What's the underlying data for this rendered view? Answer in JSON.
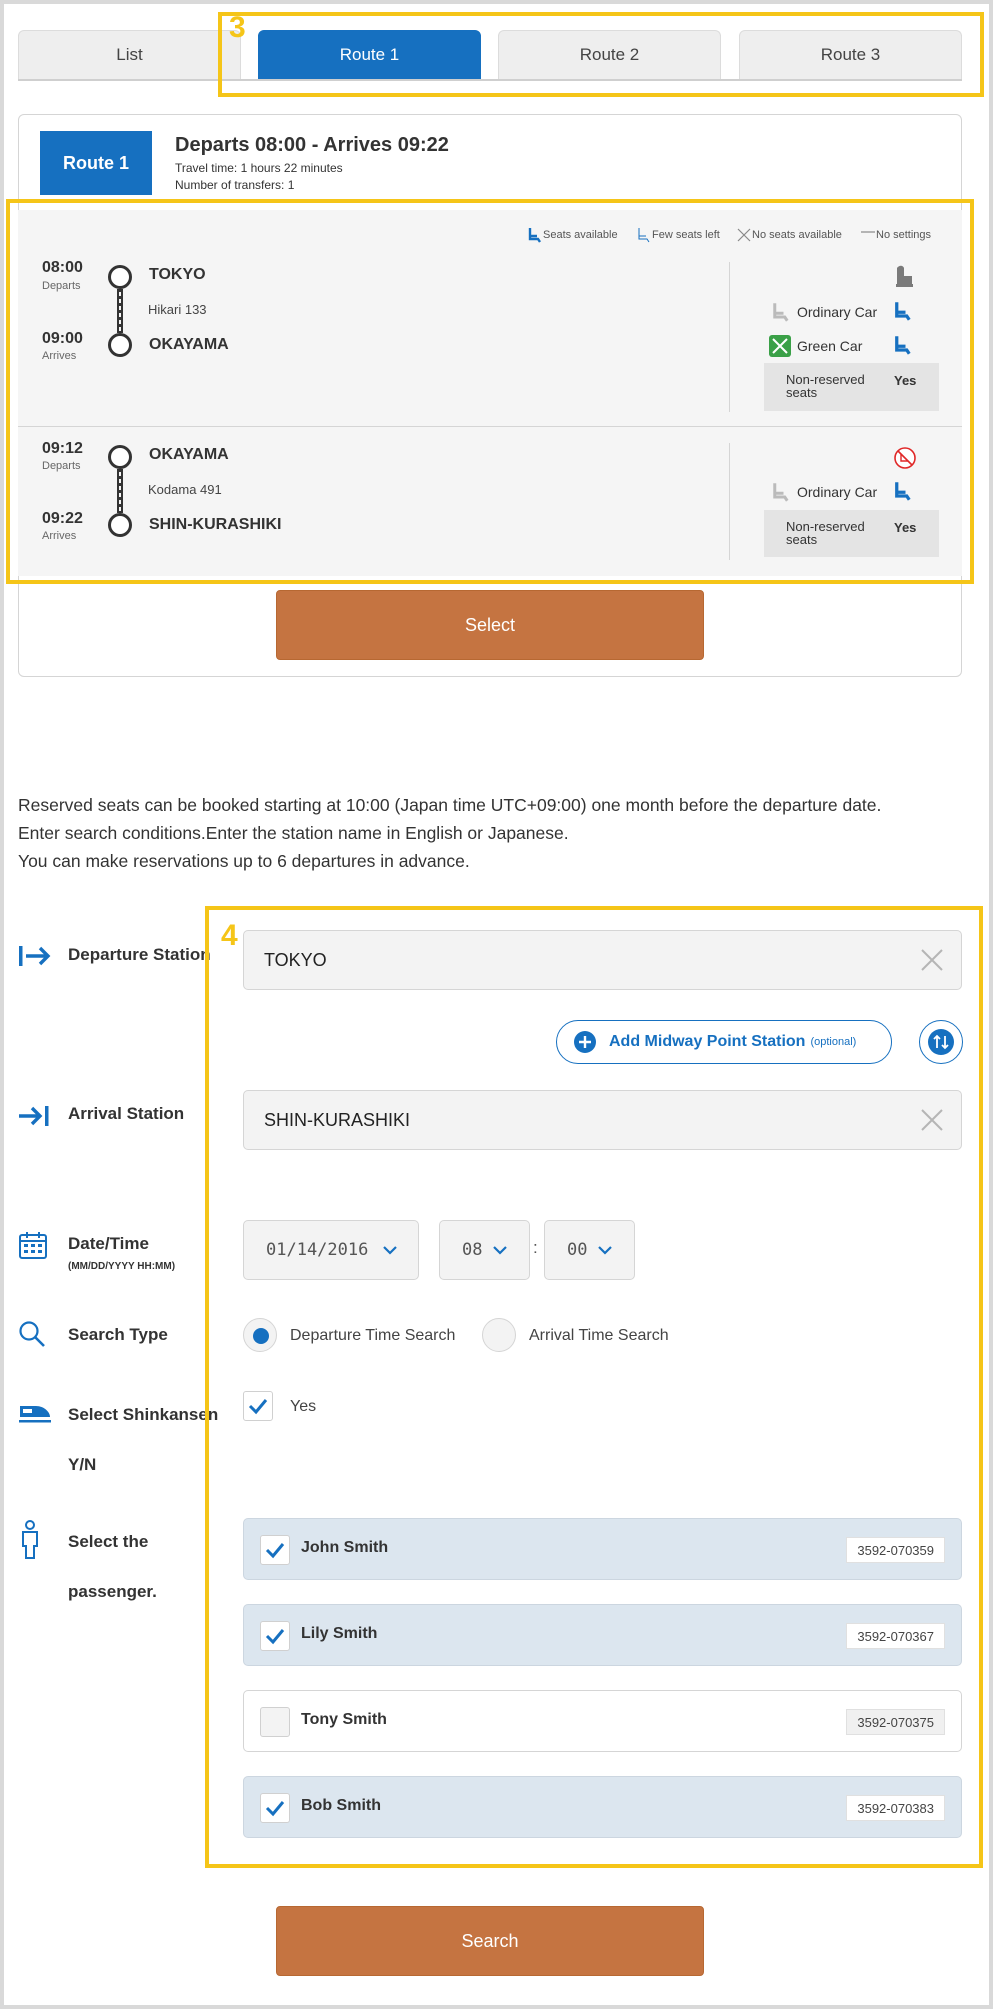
{
  "tabs": [
    {
      "label": "List"
    },
    {
      "label": "Route 1"
    },
    {
      "label": "Route 2"
    },
    {
      "label": "Route 3"
    }
  ],
  "annotations": {
    "box3": "3",
    "box4": "4"
  },
  "summary": {
    "badge": "Route 1",
    "title": "Departs 08:00 - Arrives 09:22",
    "travel_time": "Travel time: 1 hours 22 minutes",
    "transfers": "Number of transfers: 1"
  },
  "legend": {
    "seats_available": "Seats available",
    "few_seats": "Few seats left",
    "no_seats": "No seats available",
    "no_settings": "No settings"
  },
  "legs": [
    {
      "dep_time": "08:00",
      "dep_label": "Departs",
      "dep_station": "TOKYO",
      "train": "Hikari 133",
      "arr_time": "09:00",
      "arr_label": "Arrives",
      "arr_station": "OKAYAMA",
      "ordinary": "Ordinary Car",
      "green": "Green Car",
      "nonreserved_label": "Non-reserved seats",
      "nonreserved_value": "Yes"
    },
    {
      "dep_time": "09:12",
      "dep_label": "Departs",
      "dep_station": "OKAYAMA",
      "train": "Kodama 491",
      "arr_time": "09:22",
      "arr_label": "Arrives",
      "arr_station": "SHIN-KURASHIKI",
      "ordinary": "Ordinary Car",
      "nonreserved_label": "Non-reserved seats",
      "nonreserved_value": "Yes"
    }
  ],
  "select_button": "Select",
  "info": [
    "Reserved seats can be booked starting at 10:00 (Japan time UTC+09:00) one month before the departure date.",
    "Enter search conditions.Enter the station name in English or Japanese.",
    "You can make reservations up to 6 departures in advance."
  ],
  "form": {
    "departure_label": "Departure Station",
    "departure_value": "TOKYO",
    "midway_label": "Add Midway Point Station",
    "midway_optional": "(optional)",
    "arrival_label": "Arrival Station",
    "arrival_value": "SHIN-KURASHIKI",
    "datetime_label": "Date/Time",
    "datetime_format": "(MM/DD/YYYY HH:MM)",
    "date_value": "01/14/2016",
    "hour_value": "08",
    "minute_value": "00",
    "time_sep": ":",
    "search_type_label": "Search Type",
    "search_departure": "Departure Time Search",
    "search_arrival": "Arrival Time Search",
    "shinkansen_label": "Select Shinkansen",
    "shinkansen_yn": "Y/N",
    "shinkansen_yes": "Yes",
    "passenger_label_1": "Select the",
    "passenger_label_2": "passenger."
  },
  "passengers": [
    {
      "name": "John Smith",
      "id": "3592-070359",
      "checked": true
    },
    {
      "name": "Lily Smith",
      "id": "3592-070367",
      "checked": true
    },
    {
      "name": "Tony Smith",
      "id": "3592-070375",
      "checked": false
    },
    {
      "name": "Bob Smith",
      "id": "3592-070383",
      "checked": true
    }
  ],
  "search_button": "Search",
  "colors": {
    "brand_blue": "#1670c0",
    "orange": "#c57441",
    "highlight": "#f5c518"
  }
}
